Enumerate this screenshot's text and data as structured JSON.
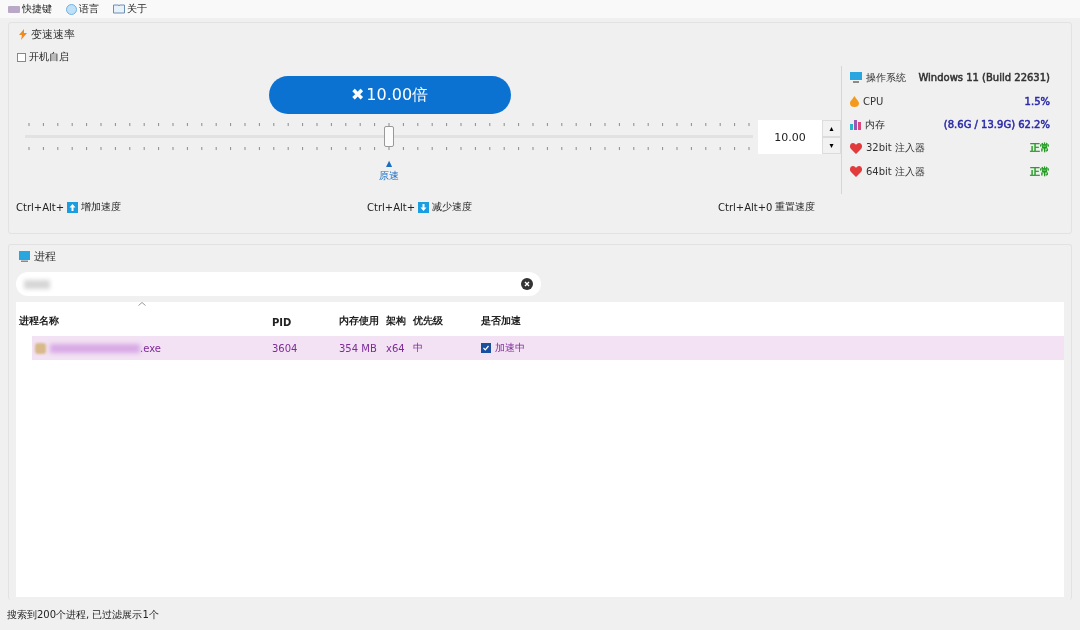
{
  "menu": [
    {
      "kind": "keyboard",
      "label": "快捷键"
    },
    {
      "kind": "globe",
      "label": "语言"
    },
    {
      "kind": "book",
      "label": "关于"
    }
  ],
  "speed_group": {
    "title": "变速速率",
    "autostart": {
      "label": "开机自启",
      "checked": false
    },
    "speed_button": "10.00倍",
    "speed_button_icon": "✖",
    "slider": {
      "level": 0.5,
      "origin_label": "原速",
      "origin_marker": "▲"
    },
    "spin_value": "10.00",
    "spin_up": "▴",
    "spin_down": "▾",
    "hotkeys": [
      {
        "keys": "Ctrl+Alt+",
        "kind": "up",
        "action": "增加速度"
      },
      {
        "keys": "Ctrl+Alt+",
        "kind": "down",
        "action": "减少速度"
      },
      {
        "keys": "Ctrl+Alt+0",
        "kind": "none",
        "action": "重置速度"
      }
    ]
  },
  "system_info": [
    {
      "kind": "monitor",
      "label": "操作系统",
      "value": "Windows 11 (Build 22631)",
      "color": "#333333"
    },
    {
      "kind": "flame",
      "label": "CPU",
      "value": "1.5%",
      "color": "#2b2ba8"
    },
    {
      "kind": "chart",
      "label": "内存",
      "value": "(8.6G / 13.9G) 62.2%",
      "color": "#2b2ba8"
    },
    {
      "kind": "heart",
      "label": "32bit 注入器",
      "value": "正常",
      "color": "#1e9a1e"
    },
    {
      "kind": "heart",
      "label": "64bit 注入器",
      "value": "正常",
      "color": "#1e9a1e"
    }
  ],
  "process_group": {
    "title": "进程",
    "search": {
      "value_blurred": true
    },
    "table": {
      "columns": [
        "进程名称",
        "PID",
        "内存使用",
        "架构",
        "优先级",
        "是否加速"
      ],
      "rows": [
        {
          "name": ".exe",
          "pid": "3604",
          "memory": "354 MB",
          "arch": "x64",
          "priority": "中",
          "accelerated": {
            "checked": true,
            "label": "加速中"
          },
          "selected": true
        }
      ]
    }
  },
  "status_bar": "搜索到200个进程, 已过滤展示1个"
}
